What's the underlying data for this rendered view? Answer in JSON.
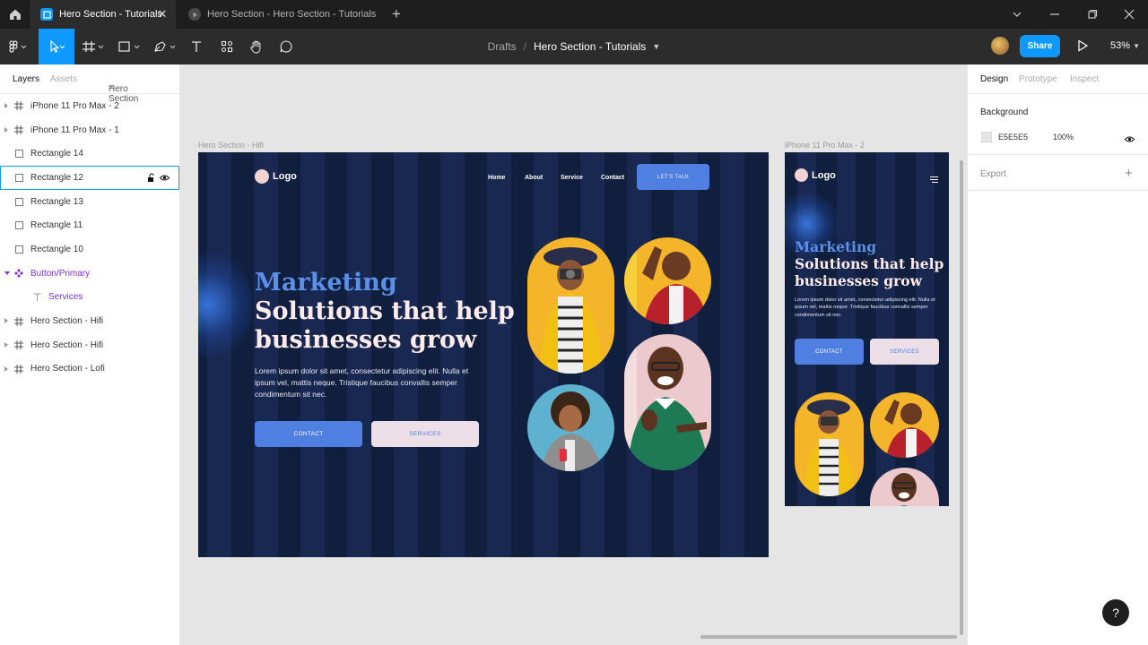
{
  "tabs": {
    "active_title": "Hero Section - Tutorials",
    "inactive_title": "Hero Section - Hero Section - Tutorials"
  },
  "toolbar": {
    "crumb_drafts": "Drafts",
    "crumb_separator": "/",
    "file_name": "Hero Section - Tutorials",
    "share_label": "Share",
    "zoom": "53%"
  },
  "left_panel": {
    "tab_layers": "Layers",
    "tab_assets": "Assets",
    "page": "Hero Section",
    "layers": [
      {
        "label": "iPhone 11 Pro Max - 2",
        "type": "frame"
      },
      {
        "label": "iPhone 11 Pro Max - 1",
        "type": "frame"
      },
      {
        "label": "Rectangle 14",
        "type": "rect"
      },
      {
        "label": "Rectangle 12",
        "type": "rect",
        "selected": true
      },
      {
        "label": "Rectangle 13",
        "type": "rect"
      },
      {
        "label": "Rectangle 11",
        "type": "rect"
      },
      {
        "label": "Rectangle 10",
        "type": "rect"
      },
      {
        "label": "Button/Primary",
        "type": "component"
      },
      {
        "label": "Services",
        "type": "text"
      },
      {
        "label": "Hero Section - Hifi",
        "type": "frame"
      },
      {
        "label": "Hero Section - Hifi",
        "type": "frame"
      },
      {
        "label": "Hero Section - Lofi",
        "type": "frame"
      }
    ]
  },
  "right_panel": {
    "tab_design": "Design",
    "tab_prototype": "Prototype",
    "tab_inspect": "Inspect",
    "background_title": "Background",
    "bg_hex": "E5E5E5",
    "bg_opacity": "100%",
    "export_title": "Export",
    "help": "?"
  },
  "canvas": {
    "desktop_label": "Hero Section - Hifi",
    "mobile_label": "iPhone 11 Pro Max - 2"
  },
  "desktop": {
    "logo": "Logo",
    "nav": [
      "Home",
      "About",
      "Service",
      "Contact"
    ],
    "cta": "LET'S TALK",
    "headline_blue": "Marketing",
    "headline_1": "Solutions that help",
    "headline_2": "businesses grow",
    "paragraph": "Lorem ipsum dolor sit amet, consectetur adipiscing elit. Nulla et ipsum vel, mattis neque. Tristique faucibus convallis semper condimentum sit nec.",
    "contact": "CONTACT",
    "services": "SERVICES"
  },
  "mobile": {
    "logo": "Logo",
    "headline_blue": "Marketing",
    "headline_1": "Solutions that help",
    "headline_2": "businesses grow",
    "paragraph": "Lorem ipsum dolor sit amet, consectetur adipiscing elit. Nulla et ipsum vel, mattis neque. Tristique faucibus convallis semper condimentum sit nec.",
    "contact": "CONTACT",
    "services": "SERVICES"
  },
  "colors": {
    "accent": "#0d99ff",
    "frame_bg": "#0f1f3d",
    "brand_blue": "#4f7fe0",
    "component_purple": "#7b2fe3"
  }
}
